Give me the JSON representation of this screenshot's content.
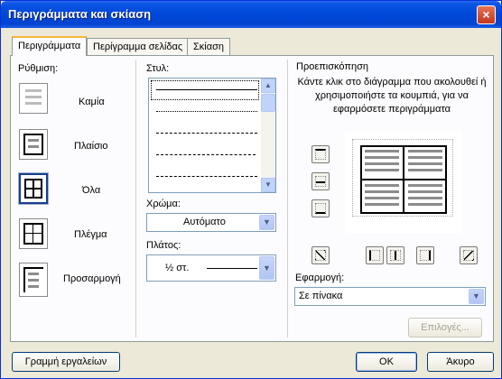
{
  "window": {
    "title": "Περιγράμματα και σκίαση",
    "close_glyph": "×"
  },
  "tabs": [
    {
      "label": "Περιγράμματα",
      "active": true
    },
    {
      "label": "Περίγραμμα σελίδας",
      "active": false
    },
    {
      "label": "Σκίαση",
      "active": false
    }
  ],
  "setting": {
    "label": "Ρύθμιση:",
    "options": [
      {
        "label": "Καμία",
        "icon": "no-border-icon"
      },
      {
        "label": "Πλαίσιο",
        "icon": "box-border-icon"
      },
      {
        "label": "Όλα",
        "icon": "all-borders-icon",
        "selected": true
      },
      {
        "label": "Πλέγμα",
        "icon": "grid-border-icon"
      },
      {
        "label": "Προσαρμογή",
        "icon": "custom-border-icon"
      }
    ]
  },
  "style": {
    "label": "Στυλ:",
    "lines": [
      "solid",
      "dotted",
      "dashed-fine",
      "dashed",
      "dash-dot"
    ]
  },
  "color": {
    "label": "Χρώμα:",
    "value": "Αυτόματο"
  },
  "width": {
    "label": "Πλάτος:",
    "value": "½ στ."
  },
  "preview": {
    "label": "Προεπισκόπηση",
    "instructions": "Κάντε κλικ στο διάγραμμα που ακολουθεί ή χρησιμοποιήστε τα κουμπιά, για να εφαρμόσετε περιγράμματα"
  },
  "apply_to": {
    "label": "Εφαρμογή:",
    "value": "Σε πίνακα"
  },
  "buttons": {
    "options": "Επιλογές...",
    "toolbar": "Γραμμή εργαλείων",
    "ok": "OK",
    "cancel": "Άκυρο"
  }
}
